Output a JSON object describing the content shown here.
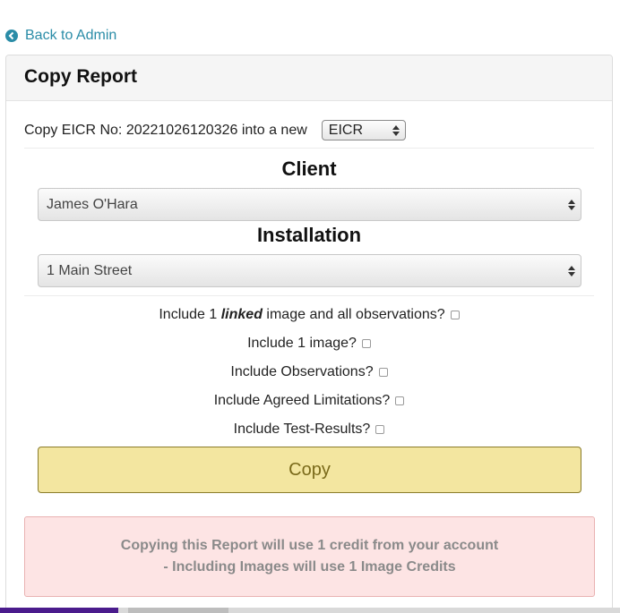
{
  "nav": {
    "back_label": "Back to Admin"
  },
  "panel": {
    "title": "Copy Report"
  },
  "copy_row": {
    "text": "Copy EICR No: 20221026120326 into a new",
    "type_selected": "EICR"
  },
  "client": {
    "heading": "Client",
    "selected": "James O'Hara"
  },
  "installation": {
    "heading": "Installation",
    "selected": "1 Main Street"
  },
  "options": {
    "linked_prefix": "Include 1",
    "linked_word": "linked",
    "linked_suffix": "image and all observations?",
    "images": "Include 1 image?",
    "observations": "Include Observations?",
    "limitations": "Include Agreed Limitations?",
    "test_results": "Include Test-Results?"
  },
  "copy_button": {
    "label": "Copy"
  },
  "alert": {
    "line1": "Copying this Report will use 1 credit from your account",
    "line2": "- Including Images will use 1 Image Credits"
  },
  "colors": {
    "link": "#2a8ca7",
    "button_bg": "#f3e6a0",
    "alert_bg": "#fde4e4"
  }
}
